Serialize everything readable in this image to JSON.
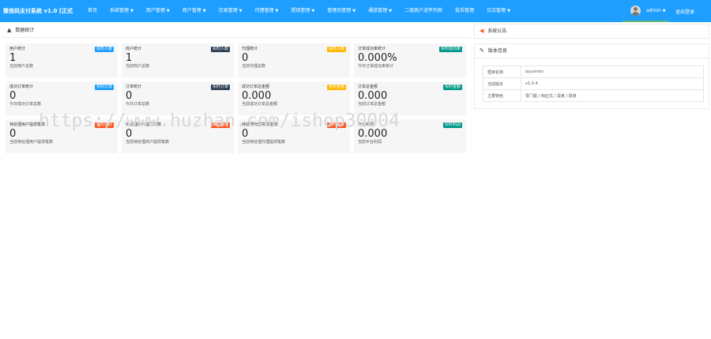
{
  "app": {
    "title": "微信码支付系统 v1.0 [正式"
  },
  "nav": [
    {
      "label": "首页",
      "dropdown": false
    },
    {
      "label": "系统管理",
      "dropdown": true
    },
    {
      "label": "用户管理",
      "dropdown": true
    },
    {
      "label": "商户管理",
      "dropdown": true
    },
    {
      "label": "交易管理",
      "dropdown": true
    },
    {
      "label": "代理管理",
      "dropdown": true
    },
    {
      "label": "提现管理",
      "dropdown": true
    },
    {
      "label": "管理员管理",
      "dropdown": true
    },
    {
      "label": "通道管理",
      "dropdown": true
    },
    {
      "label": "二级商户进件列表",
      "dropdown": false
    },
    {
      "label": "投诉管理",
      "dropdown": false
    },
    {
      "label": "日志管理",
      "dropdown": true
    }
  ],
  "user": {
    "name": "admin",
    "logout": "退出登录"
  },
  "stats_panel": {
    "title": "数据统计"
  },
  "cards": [
    {
      "title": "用户统计",
      "badge": "实时人数",
      "badge_color": "#1e9fff",
      "value": "1",
      "sub": "当前用户总数"
    },
    {
      "title": "商户统计",
      "badge": "实时人数",
      "badge_color": "#2f4056",
      "value": "1",
      "sub": "当前商户总数"
    },
    {
      "title": "代理统计",
      "badge": "实时人数",
      "badge_color": "#ffb800",
      "value": "0",
      "sub": "当前代理总数"
    },
    {
      "title": "订单成功率统计",
      "badge": "实时成功率",
      "badge_color": "#009688",
      "value": "0.000%",
      "sub": "今日订单成功率统计"
    },
    {
      "title": "成功订单统计",
      "badge": "实时订单",
      "badge_color": "#1e9fff",
      "value": "0",
      "sub": "今日成功订单总数"
    },
    {
      "title": "订单统计",
      "badge": "实时订单",
      "badge_color": "#2f4056",
      "value": "0",
      "sub": "今日订单总数"
    },
    {
      "title": "成功订单总金额",
      "badge": "实时金额",
      "badge_color": "#ffb800",
      "value": "0.000",
      "sub": "当前成功订单总金额"
    },
    {
      "title": "订单总金额",
      "badge": "实时金额",
      "badge_color": "#009688",
      "value": "0.000",
      "sub": "当前订单总金额"
    },
    {
      "title": "待处理用户提现笔数",
      "badge": "实时待办",
      "badge_color": "#ff5722",
      "value": "0",
      "sub": "当前待处理用户提现笔数"
    },
    {
      "title": "待处理商户提现笔数",
      "badge": "实时待办",
      "badge_color": "#ff5722",
      "value": "0",
      "sub": "当前待处理商户提现笔数"
    },
    {
      "title": "待处理代理提现笔数",
      "badge": "实时待办",
      "badge_color": "#ff5722",
      "value": "0",
      "sub": "当前待处理代理提现笔数"
    },
    {
      "title": "平台利润",
      "badge": "实时利润",
      "badge_color": "#009688",
      "value": "0.000",
      "sub": "当前平台利润"
    }
  ],
  "notice_panel": {
    "title": "系统公告"
  },
  "version_panel": {
    "title": "版本信息",
    "rows": [
      {
        "key": "框架名称",
        "value": "layuimini"
      },
      {
        "key": "当前版本",
        "value": "v1.0.4"
      },
      {
        "key": "主要特色",
        "value": "零门槛 / 响应式 / 清爽 / 极简"
      }
    ]
  },
  "watermark": "https://www.huzhan.com/ishop30004"
}
